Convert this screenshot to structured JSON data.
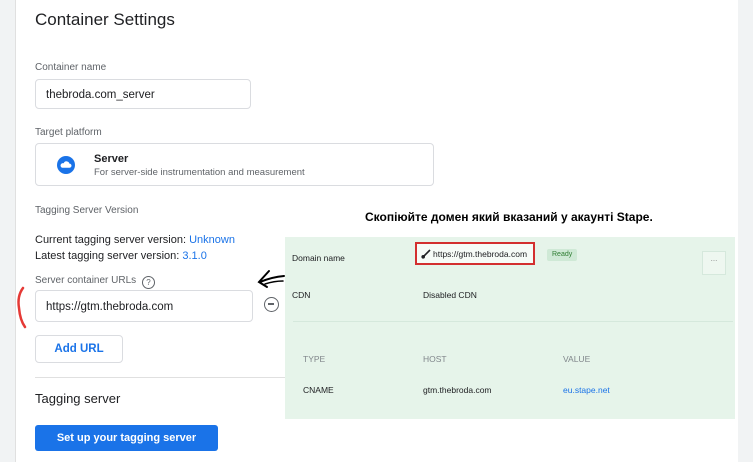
{
  "settings": {
    "title": "Container Settings",
    "container_name_label": "Container name",
    "container_name_value": "thebroda.com_server",
    "target_platform_label": "Target platform",
    "platform_name": "Server",
    "platform_desc": "For server-side instrumentation and measurement",
    "tagging_version_label": "Tagging Server Version",
    "current_version_label": "Current tagging server version:",
    "current_version_value": "Unknown",
    "latest_version_label": "Latest tagging server version:",
    "latest_version_value": "3.1.0",
    "urls_label": "Server container URLs",
    "help_glyph": "?",
    "url_value": "https://gtm.thebroda.com",
    "add_url_label": "Add URL",
    "tagging_server_section": "Tagging server",
    "setup_button": "Set up your tagging server"
  },
  "annotation": {
    "note": "Скопіюйте домен який вказаний у акаунті Stape."
  },
  "stape": {
    "domain_name_label": "Domain name",
    "domain_value": "https://gtm.thebroda.com",
    "status_badge": "Ready",
    "menu_glyph": "...",
    "cdn_label": "CDN",
    "cdn_value": "Disabled CDN",
    "table_headers": [
      "TYPE",
      "HOST",
      "VALUE"
    ],
    "table_row": [
      "CNAME",
      "gtm.thebroda.com",
      "eu.stape.net"
    ]
  },
  "colors": {
    "accent": "#1a73e8",
    "highlight_red": "#d32f2f",
    "stape_panel_bg": "#e6f4ea"
  },
  "icons": {
    "platform": "cloud-icon",
    "help": "help-icon",
    "remove": "remove-circle-icon",
    "link": "link-icon"
  }
}
